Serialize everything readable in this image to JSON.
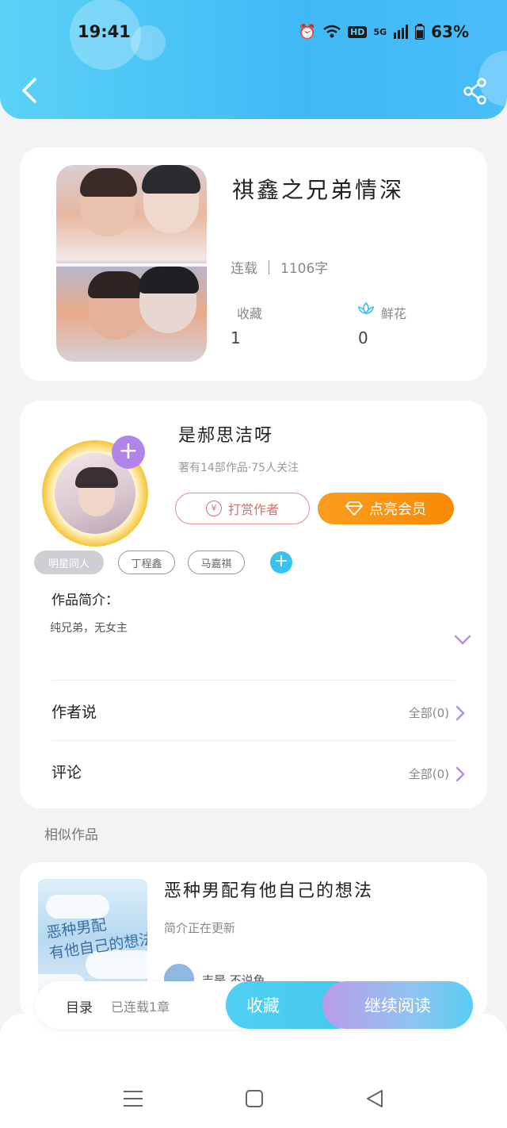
{
  "status_bar": {
    "time": "19:41",
    "hd": "HD",
    "network": "5G",
    "battery": "63%"
  },
  "book": {
    "title": "祺鑫之兄弟情深",
    "status": "连载",
    "word_count": "1106字",
    "favorites_label": "收藏",
    "favorites_count": "1",
    "flowers_label": "鲜花",
    "flowers_count": "0"
  },
  "author": {
    "name": "是郝思洁呀",
    "stats": "著有14部作品·75人关注",
    "tip_label": "打赏作者",
    "tip_icon": "¥",
    "vip_label": "点亮会员",
    "follow_icon": "+"
  },
  "tags": [
    "明星同人",
    "丁程鑫",
    "马嘉祺"
  ],
  "intro": {
    "title": "作品简介：",
    "text": "纯兄弟，无女主"
  },
  "author_says": {
    "label": "作者说",
    "right": "全部(0)"
  },
  "comments": {
    "label": "评论",
    "right": "全部(0)"
  },
  "similar": {
    "section_title": "相似作品",
    "items": [
      {
        "title": "恶种男配有他自己的想法",
        "desc": "简介正在更新",
        "author": "吉是 不说鱼",
        "cover_text": "恶种男配\n有他自己的想法"
      }
    ]
  },
  "bottom_bar": {
    "catalog": "目录",
    "status": "已连载1章",
    "favorite": "收藏",
    "continue": "继续阅读"
  },
  "colors": {
    "header": "#4bc3f6",
    "accent_purple": "#b085ea",
    "vip_orange": "#f88a05"
  },
  "icons": [
    "back-icon",
    "share-icon",
    "flower-icon",
    "diamond-icon",
    "chevron-down-icon",
    "chevron-right-icon",
    "menu-icon",
    "home-icon",
    "back-triangle-icon"
  ]
}
